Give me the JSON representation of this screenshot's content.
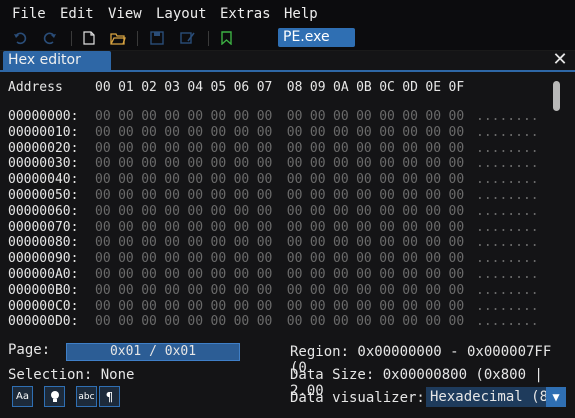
{
  "menu": [
    "File",
    "Edit",
    "View",
    "Layout",
    "Extras",
    "Help"
  ],
  "file_tab": "PE.exe",
  "panel": {
    "title": "Hex editor"
  },
  "hex": {
    "address_label": "Address",
    "columns": [
      "00",
      "01",
      "02",
      "03",
      "04",
      "05",
      "06",
      "07",
      "08",
      "09",
      "0A",
      "0B",
      "0C",
      "0D",
      "0E",
      "0F"
    ],
    "rows": [
      {
        "addr": "00000000:"
      },
      {
        "addr": "00000010:"
      },
      {
        "addr": "00000020:"
      },
      {
        "addr": "00000030:"
      },
      {
        "addr": "00000040:"
      },
      {
        "addr": "00000050:"
      },
      {
        "addr": "00000060:"
      },
      {
        "addr": "00000070:"
      },
      {
        "addr": "00000080:"
      },
      {
        "addr": "00000090:"
      },
      {
        "addr": "000000A0:"
      },
      {
        "addr": "000000B0:"
      },
      {
        "addr": "000000C0:"
      },
      {
        "addr": "000000D0:"
      }
    ],
    "byte_value": "00",
    "ascii": "........"
  },
  "footer": {
    "page_label": "Page:",
    "page_value": "0x01 / 0x01",
    "region": "Region: 0x00000000 - 0x000007FF (0",
    "selection": "Selection: None",
    "data_size": "Data Size: 0x00000800 (0x800 | 2.00",
    "visualizer_label": "Data visualizer:",
    "visualizer_value": "Hexadecimal (8",
    "buttons": [
      "Aa",
      "•",
      "abc",
      "¶"
    ]
  },
  "colors": {
    "accent": "#2e67a6",
    "tab": "#2f6fb3",
    "byte": "#6a6a6a",
    "text": "#e6e6e6"
  }
}
